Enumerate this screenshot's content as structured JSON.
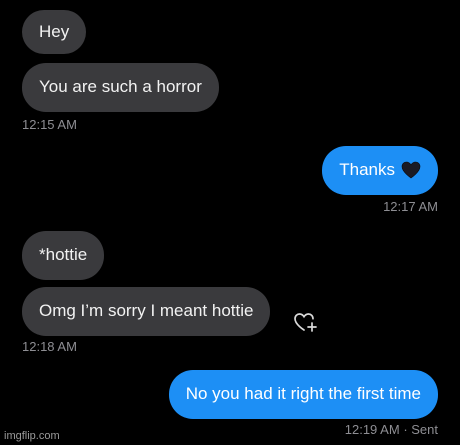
{
  "messages": [
    {
      "text": "Hey"
    },
    {
      "text": "You are such a horror"
    },
    {
      "text": "Thanks"
    },
    {
      "text": "*hottie"
    },
    {
      "text": "Omg I’m sorry I meant hottie"
    },
    {
      "text": "No you had it right the first time"
    }
  ],
  "timestamps": [
    "12:15 AM",
    "12:17 AM",
    "12:18 AM",
    "12:19 AM"
  ],
  "sent_status": "· Sent",
  "emoji": {
    "name": "black-heart-icon",
    "color": "#1a1a24"
  },
  "react_icon": {
    "name": "add-reaction-icon"
  },
  "watermark": "imgflip.com",
  "colors": {
    "incoming": "#3a3a3d",
    "outgoing": "#1d8ff5",
    "timestamp": "#8e8e93",
    "background": "#000000"
  }
}
